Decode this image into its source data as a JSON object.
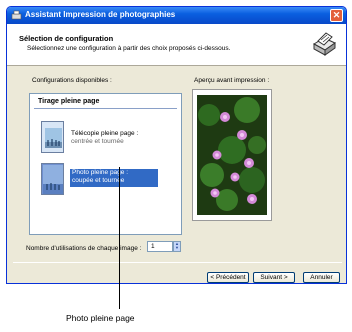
{
  "window": {
    "title": "Assistant Impression de photographies"
  },
  "header": {
    "title": "Sélection de configuration",
    "subtitle": "Sélectionnez une configuration à partir des choix proposés ci-dessous."
  },
  "configs": {
    "label": "Configurations disponibles :",
    "group_title": "Tirage pleine page",
    "options": [
      {
        "line1": "Télécopie pleine page :",
        "line2": "centrée et tournée"
      },
      {
        "line1": "Photo pleine page :",
        "line2": "coupée et tournée"
      }
    ]
  },
  "preview": {
    "label": "Aperçu avant impression :"
  },
  "usage": {
    "label": "Nombre d'utilisations de chaque image :",
    "value": "1"
  },
  "buttons": {
    "prev": "< Précédent",
    "next": "Suivant >",
    "cancel": "Annuler"
  },
  "callout": {
    "text": "Photo pleine page"
  }
}
